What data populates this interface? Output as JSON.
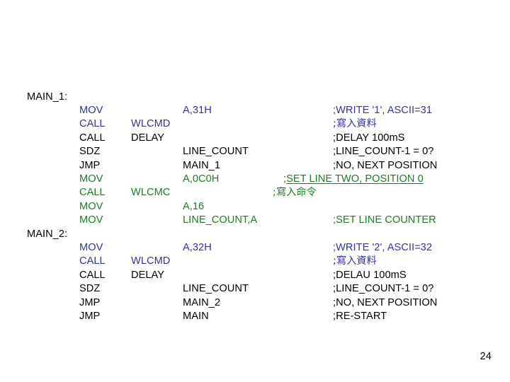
{
  "slide": {
    "page_number": "24",
    "background_color": "#ffffff"
  },
  "colors": {
    "black": "#000000",
    "blue": "#333399",
    "green": "#1e7a28"
  },
  "listing": {
    "lines": [
      {
        "label": "MAIN_1:",
        "op": "",
        "arg1": "",
        "arg2": "",
        "comment": "",
        "color": "black"
      },
      {
        "label": "",
        "op": "MOV",
        "arg1": "",
        "arg2": "A,31H",
        "comment": ";WRITE '1', ASCII=31",
        "color": "blue"
      },
      {
        "label": "",
        "op": "CALL",
        "arg1": "WLCMD",
        "arg2": "",
        "comment": ";寫入資料",
        "color": "blue"
      },
      {
        "label": "",
        "op": "CALL",
        "arg1": "DELAY",
        "arg2": "",
        "comment": ";DELAY 100mS",
        "color": "black"
      },
      {
        "label": "",
        "op": "SDZ",
        "arg1": "",
        "arg2": "LINE_COUNT",
        "comment": ";LINE_COUNT-1 = 0?",
        "color": "black"
      },
      {
        "label": "",
        "op": "JMP",
        "arg1": "",
        "arg2": "MAIN_1",
        "comment": ";NO, NEXT POSITION",
        "color": "black"
      },
      {
        "label": "",
        "op": "MOV",
        "arg1": "",
        "arg2": "A,0C0H",
        "comment": ";SET LINE TWO, POSITION 0",
        "color": "green"
      },
      {
        "label": "",
        "op": "CALL",
        "arg1": "WLCMC",
        "arg2": "",
        "comment": ";寫入命令",
        "color": "green"
      },
      {
        "label": "",
        "op": "MOV",
        "arg1": "",
        "arg2": "A,16",
        "comment": "",
        "color": "green"
      },
      {
        "label": "",
        "op": "MOV",
        "arg1": "",
        "arg2": "LINE_COUNT,A",
        "comment": ";SET LINE COUNTER",
        "color": "green"
      },
      {
        "label": "MAIN_2:",
        "op": "",
        "arg1": "",
        "arg2": "",
        "comment": "",
        "color": "black"
      },
      {
        "label": "",
        "op": "MOV",
        "arg1": "",
        "arg2": "A,32H",
        "comment": ";WRITE '2', ASCII=32",
        "color": "blue"
      },
      {
        "label": "",
        "op": "CALL",
        "arg1": "WLCMD",
        "arg2": "",
        "comment": ";寫入資料",
        "color": "blue"
      },
      {
        "label": "",
        "op": "CALL",
        "arg1": "DELAY",
        "arg2": "",
        "comment": ";DELAU 100mS",
        "color": "black"
      },
      {
        "label": "",
        "op": "SDZ",
        "arg1": "",
        "arg2": "LINE_COUNT",
        "comment": ";LINE_COUNT-1 = 0?",
        "color": "black"
      },
      {
        "label": "",
        "op": "JMP",
        "arg1": "",
        "arg2": "MAIN_2",
        "comment": ";NO, NEXT POSITION",
        "color": "black"
      },
      {
        "label": "",
        "op": "JMP",
        "arg1": "",
        "arg2": "MAIN",
        "comment": ";RE-START",
        "color": "black"
      }
    ]
  }
}
